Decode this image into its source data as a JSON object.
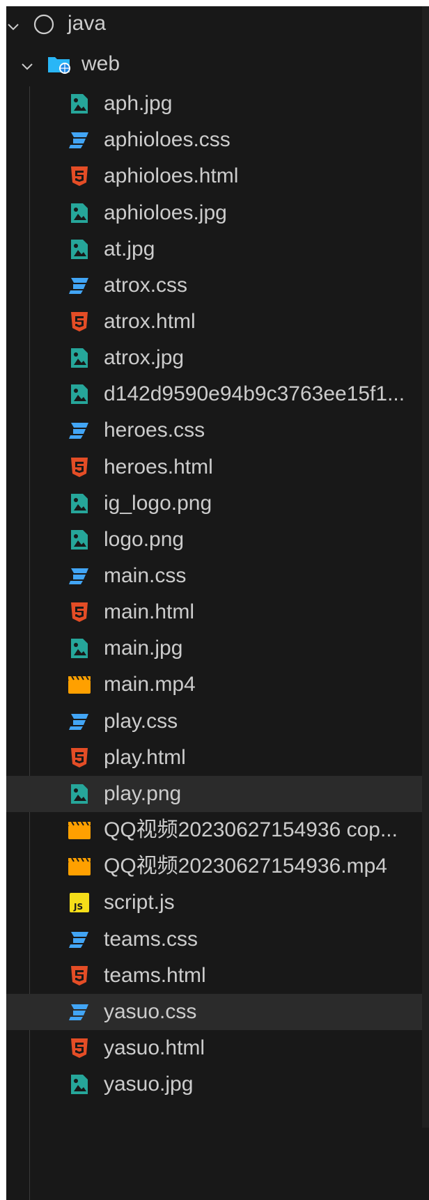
{
  "explorer": {
    "root": {
      "label": "java",
      "icon": "circle-outline-icon"
    },
    "folder": {
      "label": "web",
      "icon": "web-folder-icon"
    },
    "files": [
      {
        "label": "aph.jpg",
        "kind": "image"
      },
      {
        "label": "aphioloes.css",
        "kind": "css"
      },
      {
        "label": "aphioloes.html",
        "kind": "html"
      },
      {
        "label": "aphioloes.jpg",
        "kind": "image"
      },
      {
        "label": "at.jpg",
        "kind": "image"
      },
      {
        "label": "atrox.css",
        "kind": "css"
      },
      {
        "label": "atrox.html",
        "kind": "html"
      },
      {
        "label": "atrox.jpg",
        "kind": "image"
      },
      {
        "label": "d142d9590e94b9c3763ee15f1...",
        "kind": "image"
      },
      {
        "label": "heroes.css",
        "kind": "css"
      },
      {
        "label": "heroes.html",
        "kind": "html"
      },
      {
        "label": "ig_logo.png",
        "kind": "image"
      },
      {
        "label": "logo.png",
        "kind": "image"
      },
      {
        "label": "main.css",
        "kind": "css"
      },
      {
        "label": "main.html",
        "kind": "html"
      },
      {
        "label": "main.jpg",
        "kind": "image"
      },
      {
        "label": "main.mp4",
        "kind": "video"
      },
      {
        "label": "play.css",
        "kind": "css"
      },
      {
        "label": "play.html",
        "kind": "html"
      },
      {
        "label": "play.png",
        "kind": "image"
      },
      {
        "label": "QQ视频20230627154936 cop...",
        "kind": "video"
      },
      {
        "label": "QQ视频20230627154936.mp4",
        "kind": "video"
      },
      {
        "label": "script.js",
        "kind": "js"
      },
      {
        "label": "teams.css",
        "kind": "css"
      },
      {
        "label": "teams.html",
        "kind": "html"
      },
      {
        "label": "yasuo.css",
        "kind": "css"
      },
      {
        "label": "yasuo.html",
        "kind": "html"
      },
      {
        "label": "yasuo.jpg",
        "kind": "image"
      }
    ]
  },
  "colors": {
    "panel_bg": "#181818",
    "text": "#cccccc",
    "css": "#42a5f5",
    "html": "#e44d26",
    "image": "#26a69a",
    "video": "#ffa000",
    "js": "#f5de19",
    "hover_bg": "#2b2b2b"
  }
}
